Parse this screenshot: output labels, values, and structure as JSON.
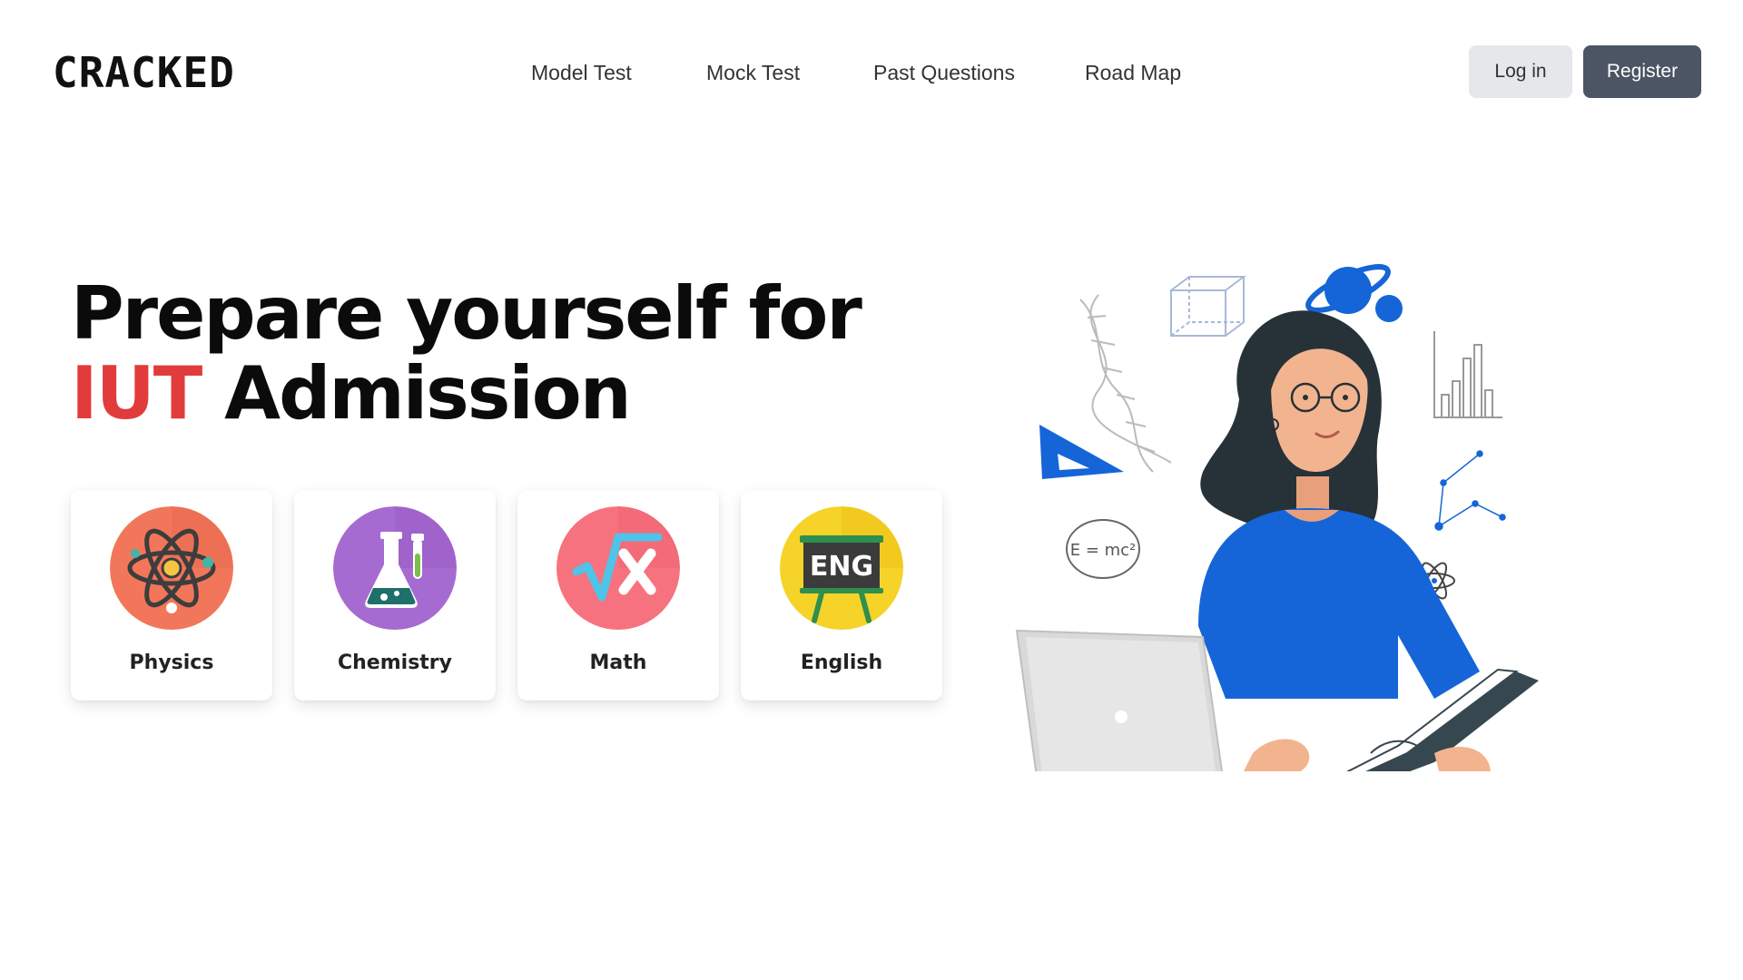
{
  "header": {
    "logo_text": "CRACKED",
    "nav": [
      {
        "label": "Model Test"
      },
      {
        "label": "Mock Test"
      },
      {
        "label": "Past Questions"
      },
      {
        "label": "Road Map"
      }
    ],
    "login_label": "Log in",
    "register_label": "Register"
  },
  "hero": {
    "title_line1": "Prepare yourself for",
    "title_accent": "IUT",
    "title_rest": "Admission",
    "accent_color": "#e23b3b"
  },
  "subjects": [
    {
      "label": "Physics",
      "icon": "atom-icon",
      "color": "#f2765a"
    },
    {
      "label": "Chemistry",
      "icon": "flask-icon",
      "color": "#a66bd0"
    },
    {
      "label": "Math",
      "icon": "square-root-x-icon",
      "color": "#f7727f"
    },
    {
      "label": "English",
      "icon": "eng-board-icon",
      "color": "#f5d329"
    }
  ],
  "illustration": {
    "equation_text": "E = mc²",
    "icon": "student-with-laptop-illustration"
  }
}
